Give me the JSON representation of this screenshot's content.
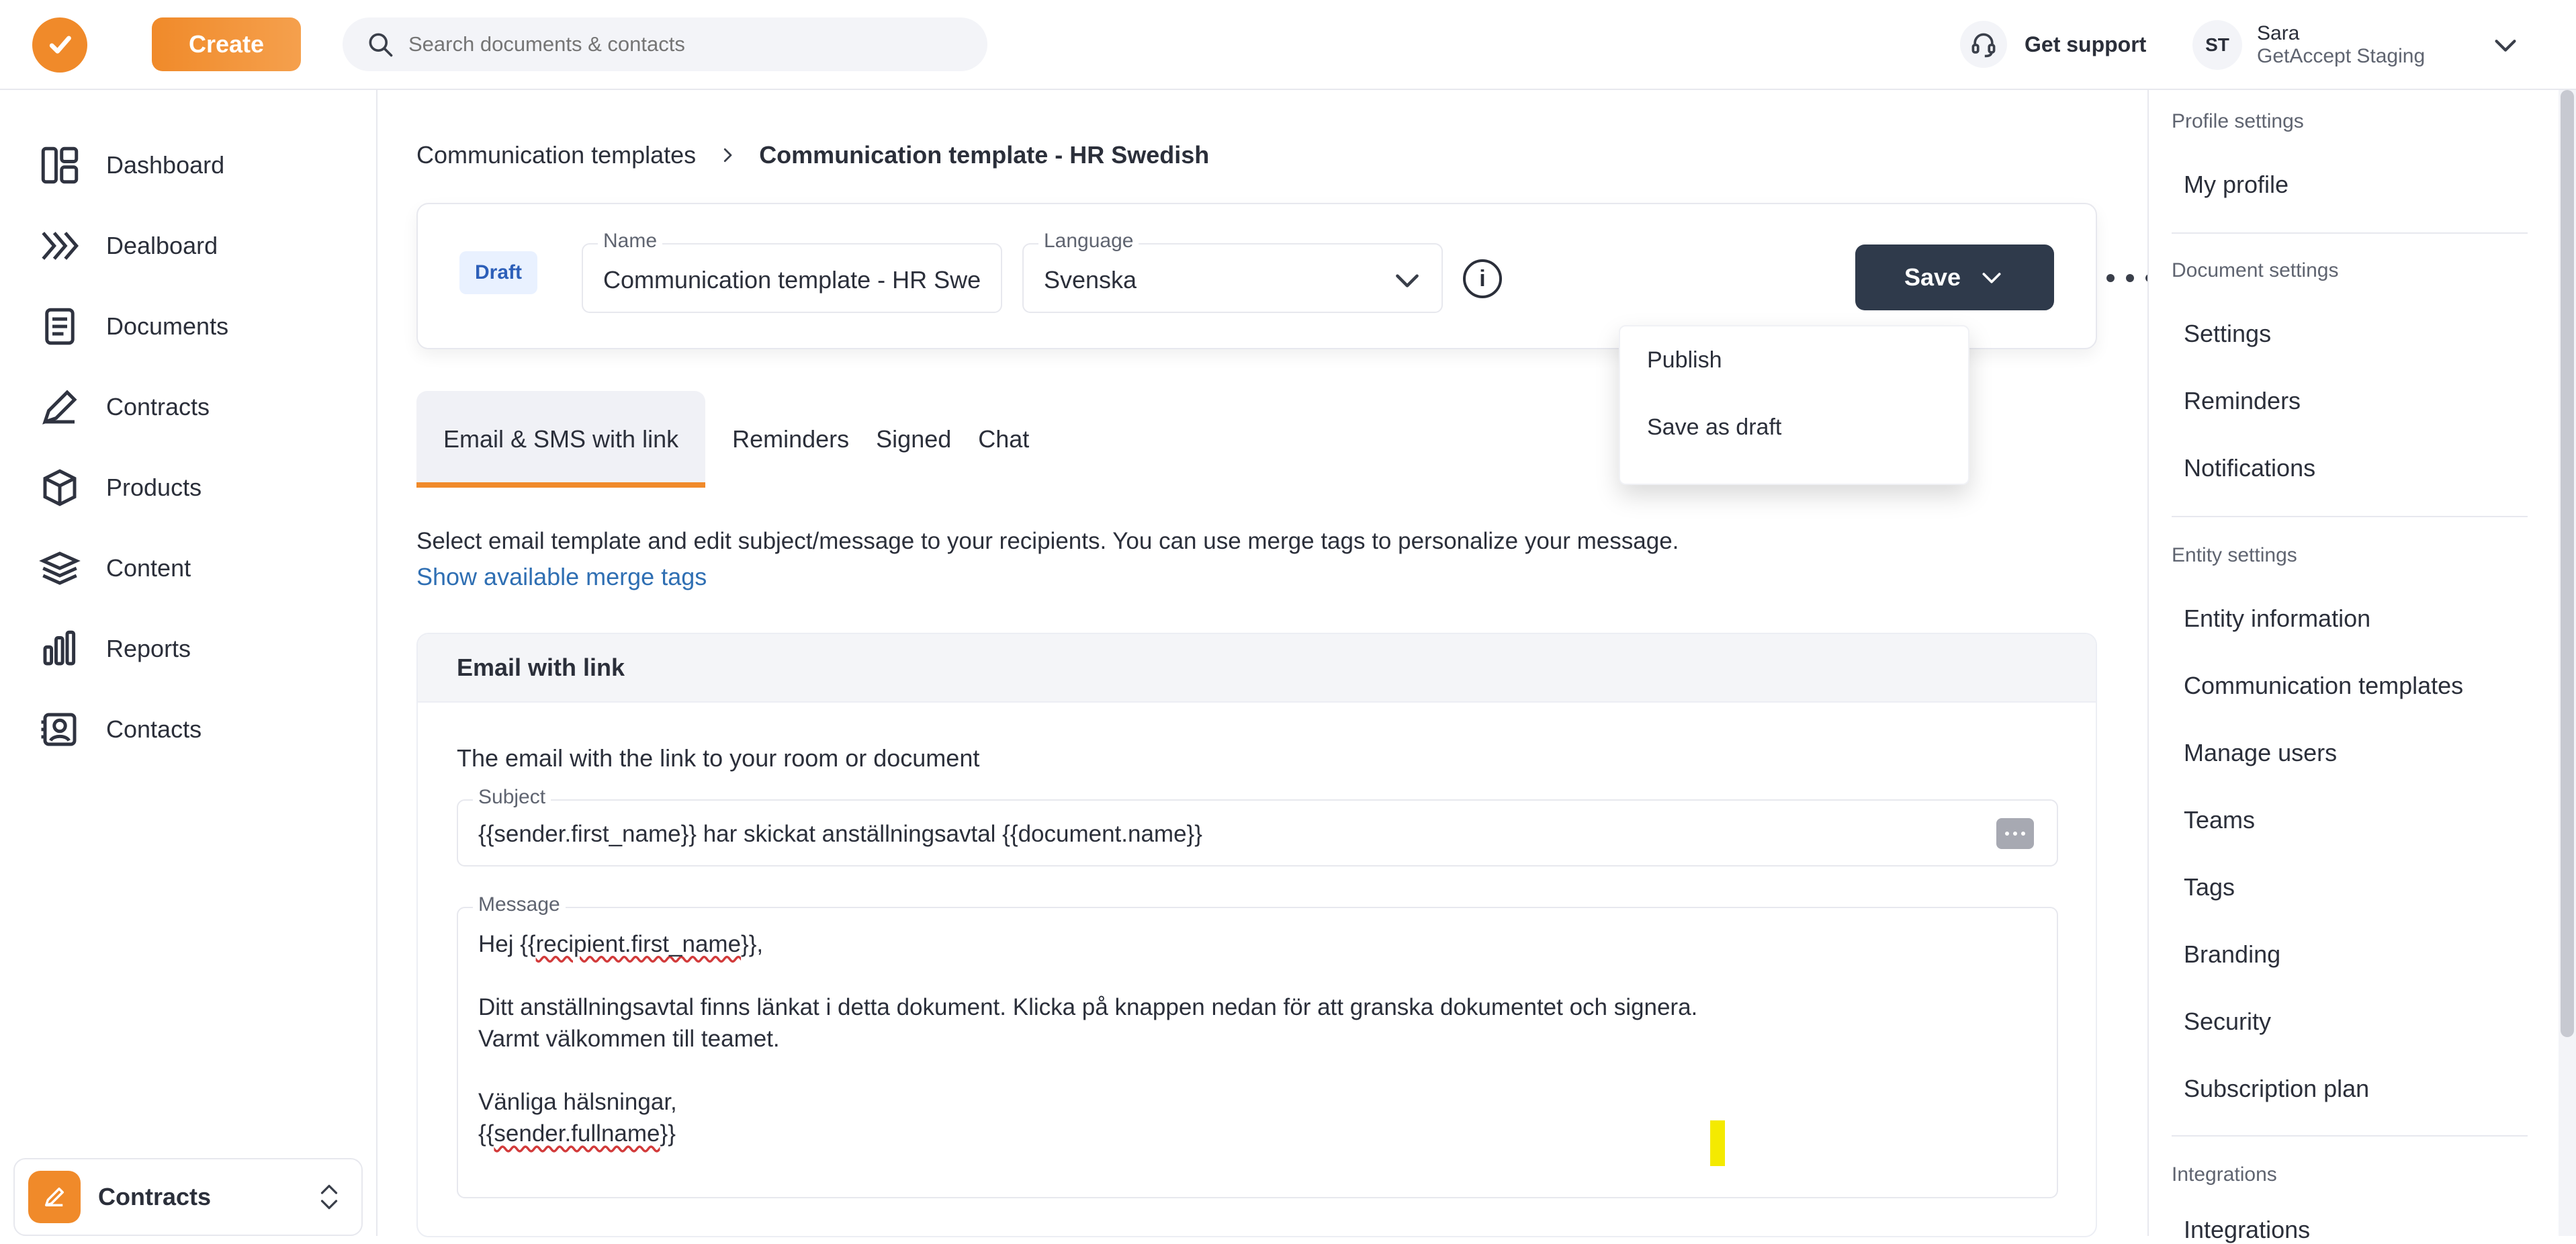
{
  "topbar": {
    "create_label": "Create",
    "search_placeholder": "Search documents & contacts",
    "support_label": "Get support",
    "user": {
      "initials": "ST",
      "name": "Sara",
      "org": "GetAccept Staging"
    }
  },
  "sidebar": {
    "items": [
      {
        "label": "Dashboard",
        "icon": "dashboard-icon"
      },
      {
        "label": "Dealboard",
        "icon": "dealboard-icon"
      },
      {
        "label": "Documents",
        "icon": "documents-icon"
      },
      {
        "label": "Contracts",
        "icon": "contracts-icon"
      },
      {
        "label": "Products",
        "icon": "products-icon"
      },
      {
        "label": "Content",
        "icon": "content-icon"
      },
      {
        "label": "Reports",
        "icon": "reports-icon"
      },
      {
        "label": "Contacts",
        "icon": "contacts-icon"
      }
    ],
    "workspace": {
      "label": "Contracts"
    }
  },
  "main": {
    "breadcrumb": {
      "parent": "Communication templates",
      "current": "Communication template - HR Swedish"
    },
    "header": {
      "badge": "Draft",
      "name_label": "Name",
      "name_value": "Communication template - HR Swe",
      "language_label": "Language",
      "language_value": "Svenska",
      "save_label": "Save"
    },
    "save_menu": {
      "options": [
        "Publish",
        "Save as draft"
      ]
    },
    "tabs": [
      {
        "label": "Email & SMS with link"
      },
      {
        "label": "Reminders"
      },
      {
        "label": "Signed"
      },
      {
        "label": "Chat"
      }
    ],
    "helptext": "Select email template and edit subject/message to your recipients. You can use merge tags to personalize your message.",
    "helplink": "Show available merge tags",
    "email_card": {
      "title": "Email with link",
      "description": "The email with the link to your room or document",
      "subject_label": "Subject",
      "subject_value": "{{sender.first_name}} har skickat anställningsavtal {{document.name}}",
      "message_label": "Message",
      "message_lines": [
        "Hej {{recipient.first_name}},",
        "",
        "Ditt anställningsavtal finns länkat i detta dokument. Klicka på knappen nedan för att granska dokumentet och signera.",
        "Varmt välkommen till teamet.",
        "",
        "Vänliga hälsningar,",
        "{{sender.fullname}}"
      ]
    }
  },
  "settings_panel": {
    "sections": [
      {
        "title": "Profile settings",
        "items": [
          "My profile"
        ]
      },
      {
        "title": "Document settings",
        "items": [
          "Settings",
          "Reminders",
          "Notifications"
        ]
      },
      {
        "title": "Entity settings",
        "items": [
          "Entity information",
          "Communication templates",
          "Manage users",
          "Teams",
          "Tags",
          "Branding",
          "Security",
          "Subscription plan"
        ]
      },
      {
        "title": "Integrations",
        "items": [
          "Integrations"
        ]
      }
    ]
  },
  "colors": {
    "accent": "#f08a2a",
    "primary_button": "#2f3a4b",
    "link": "#2f6fb3"
  }
}
